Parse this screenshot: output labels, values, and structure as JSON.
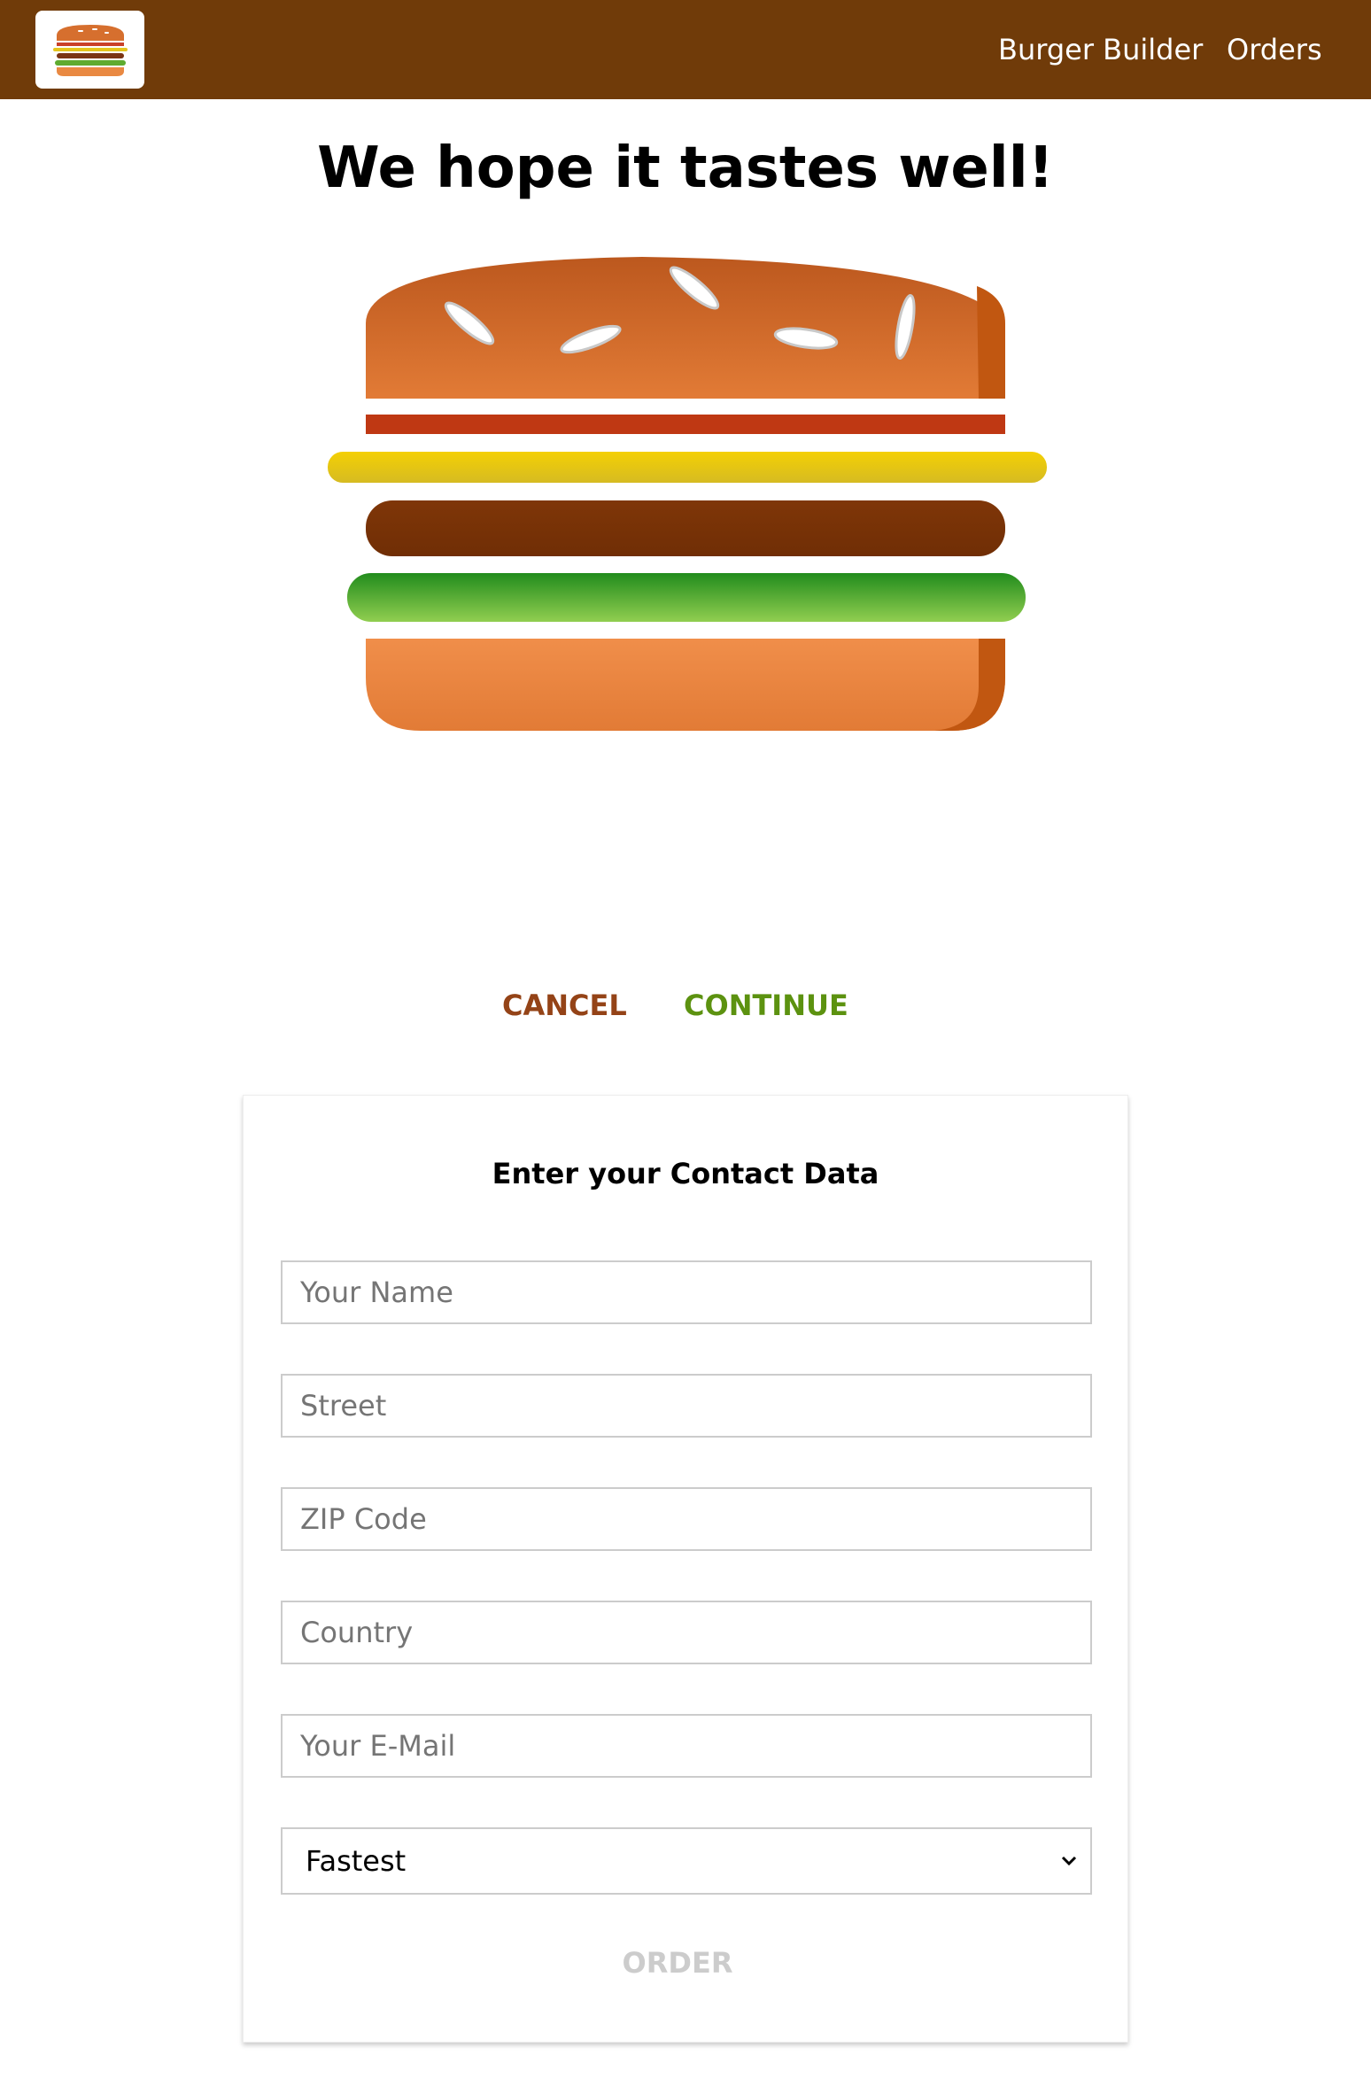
{
  "toolbar": {
    "logo_alt": "burger-logo-icon",
    "nav": [
      {
        "label": "Burger Builder"
      },
      {
        "label": "Orders"
      }
    ]
  },
  "summary": {
    "title": "We hope it tastes well!",
    "cancel_label": "CANCEL",
    "continue_label": "CONTINUE"
  },
  "contact": {
    "title": "Enter your Contact Data",
    "fields": [
      {
        "placeholder": "Your Name",
        "value": ""
      },
      {
        "placeholder": "Street",
        "value": ""
      },
      {
        "placeholder": "ZIP Code",
        "value": ""
      },
      {
        "placeholder": "Country",
        "value": ""
      },
      {
        "placeholder": "Your E-Mail",
        "value": ""
      }
    ],
    "delivery_method": "Fastest",
    "order_label": "ORDER"
  },
  "colors": {
    "toolbar": "#703b09",
    "cancel": "#944317",
    "continue": "#5c9210",
    "disabled": "#cccccc"
  }
}
